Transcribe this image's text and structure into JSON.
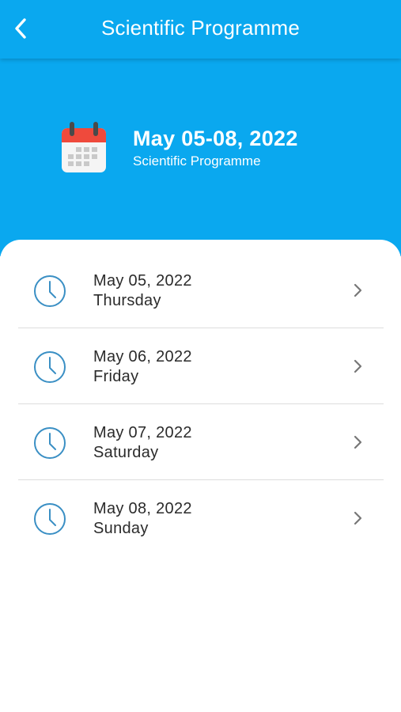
{
  "header": {
    "title": "Scientific Programme",
    "back_icon": "chevron-left-icon"
  },
  "hero": {
    "icon": "calendar-icon",
    "date_range": "May 05-08, 2022",
    "subtitle": "Scientific Programme"
  },
  "days": [
    {
      "date": "May 05, 2022",
      "weekday": "Thursday",
      "icon": "clock-icon"
    },
    {
      "date": "May 06, 2022",
      "weekday": "Friday",
      "icon": "clock-icon"
    },
    {
      "date": "May 07, 2022",
      "weekday": "Saturday",
      "icon": "clock-icon"
    },
    {
      "date": "May 08, 2022",
      "weekday": "Sunday",
      "icon": "clock-icon"
    }
  ],
  "colors": {
    "primary": "#0aa8ef",
    "clock": "#3a8fc4",
    "chevron": "#777777",
    "divider": "#dcdcdc",
    "text": "#2b2b2b"
  }
}
